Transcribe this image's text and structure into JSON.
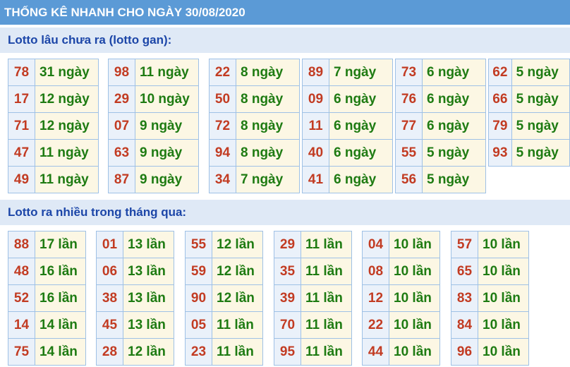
{
  "header": {
    "title": "THỐNG KÊ NHANH CHO NGÀY 30/08/2020"
  },
  "gan": {
    "title": "Lotto lâu chưa ra (lotto gan):",
    "blocks": [
      [
        [
          "78",
          "31 ngày"
        ],
        [
          "17",
          "12 ngày"
        ],
        [
          "71",
          "12 ngày"
        ],
        [
          "47",
          "11 ngày"
        ],
        [
          "49",
          "11 ngày"
        ]
      ],
      [
        [
          "98",
          "11 ngày"
        ],
        [
          "29",
          "10 ngày"
        ],
        [
          "07",
          "9 ngày"
        ],
        [
          "63",
          "9 ngày"
        ],
        [
          "87",
          "9 ngày"
        ]
      ],
      [
        [
          "22",
          "8 ngày"
        ],
        [
          "50",
          "8 ngày"
        ],
        [
          "72",
          "8 ngày"
        ],
        [
          "94",
          "8 ngày"
        ],
        [
          "34",
          "7 ngày"
        ]
      ],
      [
        [
          "89",
          "7 ngày"
        ],
        [
          "09",
          "6 ngày"
        ],
        [
          "11",
          "6 ngày"
        ],
        [
          "40",
          "6 ngày"
        ],
        [
          "41",
          "6 ngày"
        ]
      ],
      [
        [
          "73",
          "6 ngày"
        ],
        [
          "76",
          "6 ngày"
        ],
        [
          "77",
          "6 ngày"
        ],
        [
          "55",
          "5 ngày"
        ],
        [
          "56",
          "5 ngày"
        ]
      ],
      [
        [
          "62",
          "5 ngày"
        ],
        [
          "66",
          "5 ngày"
        ],
        [
          "79",
          "5 ngày"
        ],
        [
          "93",
          "5 ngày"
        ]
      ]
    ]
  },
  "nhieu": {
    "title": "Lotto ra nhiều trong tháng qua:",
    "blocks": [
      [
        [
          "88",
          "17 lần"
        ],
        [
          "48",
          "16 lần"
        ],
        [
          "52",
          "16 lần"
        ],
        [
          "14",
          "14 lần"
        ],
        [
          "75",
          "14 lần"
        ]
      ],
      [
        [
          "01",
          "13 lần"
        ],
        [
          "06",
          "13 lần"
        ],
        [
          "38",
          "13 lần"
        ],
        [
          "45",
          "13 lần"
        ],
        [
          "28",
          "12 lần"
        ]
      ],
      [
        [
          "55",
          "12 lần"
        ],
        [
          "59",
          "12 lần"
        ],
        [
          "90",
          "12 lần"
        ],
        [
          "05",
          "11 lần"
        ],
        [
          "23",
          "11 lần"
        ]
      ],
      [
        [
          "29",
          "11 lần"
        ],
        [
          "35",
          "11 lần"
        ],
        [
          "39",
          "11 lần"
        ],
        [
          "70",
          "11 lần"
        ],
        [
          "95",
          "11 lần"
        ]
      ],
      [
        [
          "04",
          "10 lần"
        ],
        [
          "08",
          "10 lần"
        ],
        [
          "12",
          "10 lần"
        ],
        [
          "22",
          "10 lần"
        ],
        [
          "44",
          "10 lần"
        ]
      ],
      [
        [
          "57",
          "10 lần"
        ],
        [
          "65",
          "10 lần"
        ],
        [
          "83",
          "10 lần"
        ],
        [
          "84",
          "10 lần"
        ],
        [
          "96",
          "10 lần"
        ]
      ]
    ]
  }
}
